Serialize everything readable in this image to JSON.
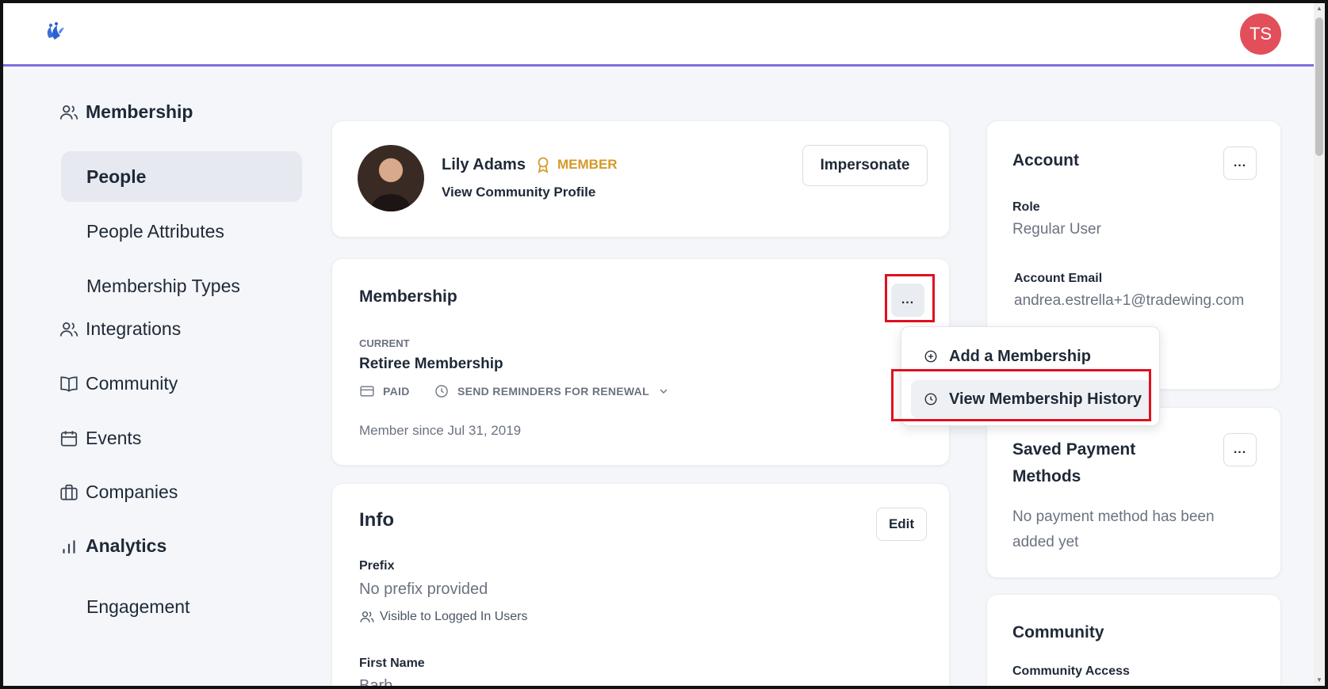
{
  "header": {
    "user_initials": "TS"
  },
  "sidebar": {
    "sections": [
      {
        "label": "Membership",
        "icon": "users-icon"
      },
      {
        "label": "Integrations",
        "icon": "users-icon"
      },
      {
        "label": "Community",
        "icon": "book-icon"
      },
      {
        "label": "Events",
        "icon": "calendar-icon"
      },
      {
        "label": "Companies",
        "icon": "briefcase-icon"
      },
      {
        "label": "Analytics",
        "icon": "bar-chart-icon"
      }
    ],
    "membership_items": [
      "People",
      "People Attributes",
      "Membership Types"
    ],
    "analytics_items": [
      "Engagement"
    ]
  },
  "profile": {
    "name": "Lily Adams",
    "badge": "MEMBER",
    "link": "View Community Profile",
    "impersonate_label": "Impersonate"
  },
  "membership_card": {
    "title": "Membership",
    "more_label": "...",
    "current_label": "CURRENT",
    "plan_name": "Retiree Membership",
    "paid_label": "PAID",
    "reminders_label": "SEND REMINDERS FOR RENEWAL",
    "member_since": "Member since Jul 31, 2019"
  },
  "dropdown": {
    "items": [
      "Add a Membership",
      "View Membership History"
    ]
  },
  "info_card": {
    "title": "Info",
    "edit_label": "Edit",
    "prefix_label": "Prefix",
    "prefix_value": "No prefix provided",
    "visibility": "Visible to Logged In Users",
    "first_name_label": "First Name",
    "first_name_value": "Barb"
  },
  "account_card": {
    "title": "Account",
    "more_label": "...",
    "role_label": "Role",
    "role_value": "Regular User",
    "email_label": "Account Email",
    "email_value": "andrea.estrella+1@tradewing.com"
  },
  "payment_card": {
    "title_line1": "Saved Payment",
    "title_line2": "Methods",
    "more_label": "...",
    "empty_line1": "No payment method has been",
    "empty_line2": "added yet"
  },
  "community_card": {
    "title": "Community",
    "access_label": "Community Access"
  },
  "colors": {
    "accent_line": "#7b6fe0",
    "avatar_bg": "#e24f5b",
    "badge_gold": "#d49a2a",
    "highlight_red": "#e0101e"
  }
}
